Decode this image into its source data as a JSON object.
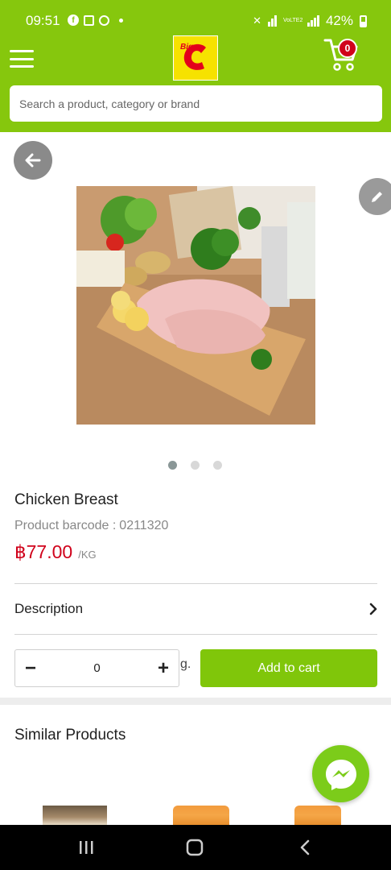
{
  "status_bar": {
    "time": "09:51",
    "battery": "42%",
    "network_label": "VoLTE2"
  },
  "header": {
    "logo_text": "Big C",
    "cart_count": "0",
    "search_placeholder": "Search a product, category or brand"
  },
  "product": {
    "name": "Chicken Breast",
    "barcode_label": "Product barcode :",
    "barcode": "0211320",
    "price": "฿77.00",
    "unit": "/KG",
    "image_count": 3,
    "active_image": 1
  },
  "description": {
    "label": "Description"
  },
  "purchase": {
    "quantity": "0",
    "unit_suffix": "g.",
    "add_to_cart_label": "Add to cart"
  },
  "similar": {
    "title": "Similar Products"
  },
  "colors": {
    "brand_green": "#86c70d",
    "price_red": "#d0021b",
    "badge_red": "#d0021b",
    "button_green": "#80c60a"
  }
}
